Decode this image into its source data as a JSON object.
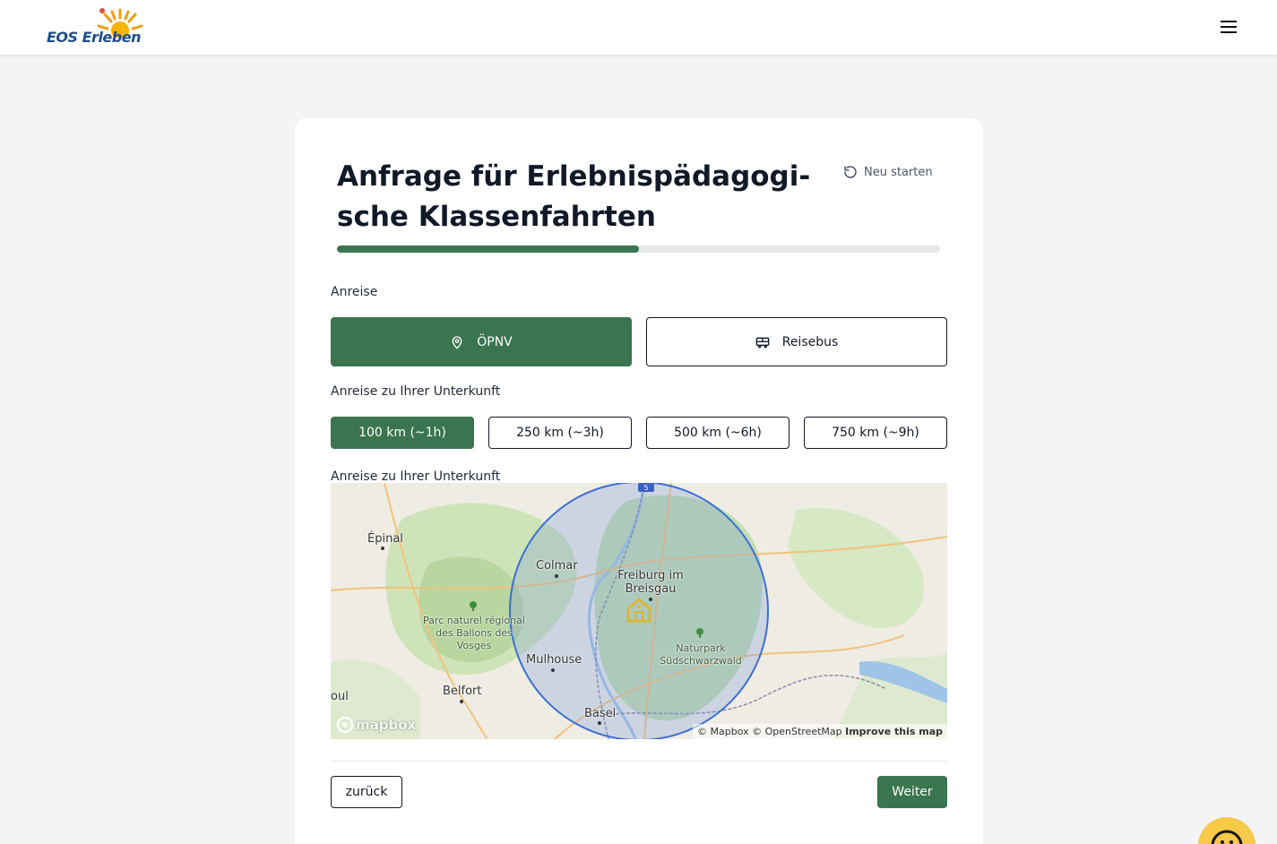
{
  "header": {
    "logo_text": "EOS Erleben",
    "menu_icon": "hamburger-menu-icon"
  },
  "form": {
    "title": "Anfrage für Erlebnispädagogi-sche Klassenfahrten",
    "restart_label": "Neu starten",
    "progress_percent": 50,
    "travel_label": "Anreise",
    "travel_options": [
      {
        "label": "ÖPNV",
        "icon": "map-pin-icon",
        "selected": true
      },
      {
        "label": "Reisebus",
        "icon": "bus-icon",
        "selected": false
      }
    ],
    "distance_label": "Anreise zu Ihrer Unterkunft",
    "distance_options": [
      {
        "label": "100 km (~1h)",
        "selected": true
      },
      {
        "label": "250 km (~3h)",
        "selected": false
      },
      {
        "label": "500 km (~6h)",
        "selected": false
      },
      {
        "label": "750 km (~9h)",
        "selected": false
      }
    ],
    "map_label": "Anreise zu Ihrer Unterkunft",
    "back_label": "zurück",
    "next_label": "Weiter"
  },
  "map": {
    "places": [
      {
        "name": "Épinal"
      },
      {
        "name": "Colmar"
      },
      {
        "name": "Freiburg im Breisgau"
      },
      {
        "name": "Parc naturel régional des Ballons des Vosges"
      },
      {
        "name": "Naturpark Südschwarzwald"
      },
      {
        "name": "Mulhouse"
      },
      {
        "name": "Belfort"
      },
      {
        "name": "Basel"
      },
      {
        "name": "oul"
      }
    ],
    "route_badge": "5",
    "attribution": "© Mapbox © OpenStreetMap",
    "improve_link": "Improve this map",
    "mapbox_logo": "mapbox",
    "radius_color": "#3b6fd4",
    "marker_color": "#e0b42c"
  },
  "colors": {
    "accent": "#3a7550",
    "background": "#f3f4f6",
    "chat_button": "#f7c948"
  }
}
